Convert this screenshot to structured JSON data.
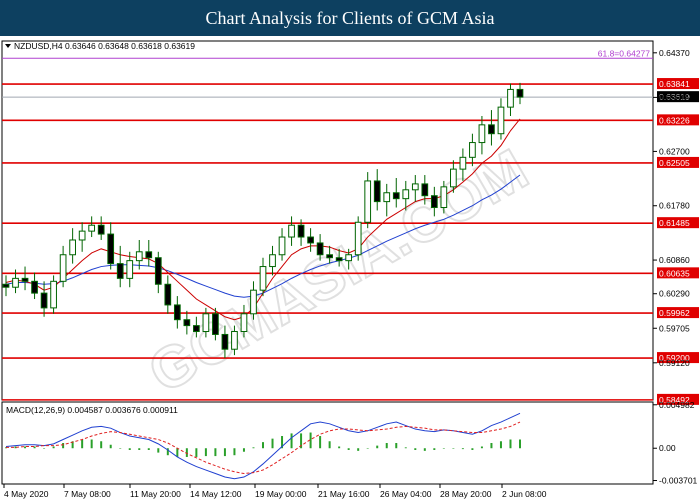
{
  "banner": {
    "title": "Chart Analysis for Clients of GCM Asia"
  },
  "watermark": {
    "text": "GCMASIA.COM"
  },
  "colors": {
    "level_line": "#e00000",
    "fib_line": "#b040d0",
    "price_line": "#a0a8b0",
    "candle_up": "#006400",
    "candle_body_down": "#000000",
    "ma_fast": "#cc0000",
    "ma_slow": "#2040d0",
    "macd_line": "#2040d0",
    "macd_signal": "#e02020",
    "macd_hist": "#2aa02a"
  },
  "chart_data": [
    {
      "type": "candlestick",
      "title": "NZDUSD,H4  0.63646 0.63648 0.63618 0.63619",
      "x_tick_labels": [
        "4 May 2020",
        "7 May 08:00",
        "11 May 20:00",
        "14 May 12:00",
        "19 May 00:00",
        "21 May 16:00",
        "26 May 04:00",
        "28 May 20:00",
        "2 Jun 08:00"
      ],
      "y_tick_labels": [
        "0.64370",
        "0.63615",
        "0.62700",
        "0.61780",
        "0.60860",
        "0.60290",
        "0.59705",
        "0.59120"
      ],
      "ylim": [
        0.5849,
        0.6457
      ],
      "levels": [
        "0.63841",
        "0.63226",
        "0.62505",
        "0.61485",
        "0.60635",
        "0.59962",
        "0.59200",
        "0.58492"
      ],
      "fib_label": "61.8=0.64277",
      "current_price": "0.63619",
      "candles": [
        {
          "o": 0.6045,
          "h": 0.606,
          "l": 0.6025,
          "c": 0.604
        },
        {
          "o": 0.604,
          "h": 0.607,
          "l": 0.603,
          "c": 0.6055
        },
        {
          "o": 0.6055,
          "h": 0.6075,
          "l": 0.6035,
          "c": 0.605
        },
        {
          "o": 0.605,
          "h": 0.6065,
          "l": 0.602,
          "c": 0.603
        },
        {
          "o": 0.603,
          "h": 0.605,
          "l": 0.599,
          "c": 0.6005
        },
        {
          "o": 0.6005,
          "h": 0.606,
          "l": 0.5995,
          "c": 0.605
        },
        {
          "o": 0.605,
          "h": 0.611,
          "l": 0.604,
          "c": 0.6095
        },
        {
          "o": 0.6095,
          "h": 0.614,
          "l": 0.608,
          "c": 0.612
        },
        {
          "o": 0.612,
          "h": 0.615,
          "l": 0.61,
          "c": 0.6135
        },
        {
          "o": 0.6135,
          "h": 0.616,
          "l": 0.6125,
          "c": 0.6145
        },
        {
          "o": 0.6145,
          "h": 0.616,
          "l": 0.612,
          "c": 0.613
        },
        {
          "o": 0.613,
          "h": 0.615,
          "l": 0.607,
          "c": 0.608
        },
        {
          "o": 0.608,
          "h": 0.611,
          "l": 0.604,
          "c": 0.6055
        },
        {
          "o": 0.6055,
          "h": 0.61,
          "l": 0.604,
          "c": 0.6085
        },
        {
          "o": 0.6085,
          "h": 0.612,
          "l": 0.607,
          "c": 0.61
        },
        {
          "o": 0.61,
          "h": 0.612,
          "l": 0.6075,
          "c": 0.609
        },
        {
          "o": 0.609,
          "h": 0.61,
          "l": 0.603,
          "c": 0.6045
        },
        {
          "o": 0.6045,
          "h": 0.606,
          "l": 0.5995,
          "c": 0.601
        },
        {
          "o": 0.601,
          "h": 0.6025,
          "l": 0.597,
          "c": 0.5985
        },
        {
          "o": 0.5985,
          "h": 0.6,
          "l": 0.596,
          "c": 0.5975
        },
        {
          "o": 0.5975,
          "h": 0.599,
          "l": 0.5955,
          "c": 0.5965
        },
        {
          "o": 0.5965,
          "h": 0.6005,
          "l": 0.5955,
          "c": 0.5995
        },
        {
          "o": 0.5995,
          "h": 0.6005,
          "l": 0.595,
          "c": 0.596
        },
        {
          "o": 0.596,
          "h": 0.5975,
          "l": 0.592,
          "c": 0.5935
        },
        {
          "o": 0.5935,
          "h": 0.5975,
          "l": 0.5925,
          "c": 0.5965
        },
        {
          "o": 0.5965,
          "h": 0.601,
          "l": 0.5955,
          "c": 0.5995
        },
        {
          "o": 0.5995,
          "h": 0.605,
          "l": 0.5985,
          "c": 0.6035
        },
        {
          "o": 0.6035,
          "h": 0.609,
          "l": 0.6025,
          "c": 0.6075
        },
        {
          "o": 0.6075,
          "h": 0.611,
          "l": 0.606,
          "c": 0.6095
        },
        {
          "o": 0.6095,
          "h": 0.614,
          "l": 0.6085,
          "c": 0.6125
        },
        {
          "o": 0.6125,
          "h": 0.616,
          "l": 0.611,
          "c": 0.6145
        },
        {
          "o": 0.6145,
          "h": 0.6155,
          "l": 0.611,
          "c": 0.6125
        },
        {
          "o": 0.6125,
          "h": 0.614,
          "l": 0.61,
          "c": 0.6115
        },
        {
          "o": 0.6115,
          "h": 0.613,
          "l": 0.6085,
          "c": 0.6095
        },
        {
          "o": 0.6095,
          "h": 0.611,
          "l": 0.608,
          "c": 0.609
        },
        {
          "o": 0.609,
          "h": 0.6105,
          "l": 0.6075,
          "c": 0.6085
        },
        {
          "o": 0.6085,
          "h": 0.6105,
          "l": 0.607,
          "c": 0.6095
        },
        {
          "o": 0.6095,
          "h": 0.616,
          "l": 0.6085,
          "c": 0.615
        },
        {
          "o": 0.615,
          "h": 0.6235,
          "l": 0.614,
          "c": 0.622
        },
        {
          "o": 0.622,
          "h": 0.624,
          "l": 0.617,
          "c": 0.6185
        },
        {
          "o": 0.6185,
          "h": 0.6215,
          "l": 0.616,
          "c": 0.62
        },
        {
          "o": 0.62,
          "h": 0.6225,
          "l": 0.6175,
          "c": 0.619
        },
        {
          "o": 0.619,
          "h": 0.622,
          "l": 0.617,
          "c": 0.6205
        },
        {
          "o": 0.6205,
          "h": 0.623,
          "l": 0.6185,
          "c": 0.6215
        },
        {
          "o": 0.6215,
          "h": 0.623,
          "l": 0.618,
          "c": 0.6195
        },
        {
          "o": 0.6195,
          "h": 0.621,
          "l": 0.616,
          "c": 0.6175
        },
        {
          "o": 0.6175,
          "h": 0.622,
          "l": 0.6165,
          "c": 0.621
        },
        {
          "o": 0.621,
          "h": 0.6255,
          "l": 0.62,
          "c": 0.624
        },
        {
          "o": 0.624,
          "h": 0.6275,
          "l": 0.622,
          "c": 0.626
        },
        {
          "o": 0.626,
          "h": 0.63,
          "l": 0.6245,
          "c": 0.6285
        },
        {
          "o": 0.6285,
          "h": 0.633,
          "l": 0.6265,
          "c": 0.6315
        },
        {
          "o": 0.6315,
          "h": 0.634,
          "l": 0.628,
          "c": 0.63
        },
        {
          "o": 0.63,
          "h": 0.636,
          "l": 0.629,
          "c": 0.6345
        },
        {
          "o": 0.6345,
          "h": 0.6385,
          "l": 0.633,
          "c": 0.6375
        },
        {
          "o": 0.6375,
          "h": 0.6386,
          "l": 0.635,
          "c": 0.6362
        }
      ],
      "ma_fast": [
        0.6048,
        0.6052,
        0.605,
        0.6045,
        0.6035,
        0.604,
        0.6055,
        0.607,
        0.6085,
        0.6098,
        0.6105,
        0.61,
        0.6095,
        0.6092,
        0.609,
        0.6088,
        0.608,
        0.6065,
        0.605,
        0.6035,
        0.602,
        0.601,
        0.6,
        0.599,
        0.5985,
        0.599,
        0.6005,
        0.603,
        0.6055,
        0.6075,
        0.6095,
        0.6105,
        0.611,
        0.611,
        0.6108,
        0.6102,
        0.6098,
        0.6105,
        0.6125,
        0.614,
        0.6155,
        0.6165,
        0.6175,
        0.6185,
        0.619,
        0.619,
        0.6195,
        0.6205,
        0.6218,
        0.6232,
        0.625,
        0.6262,
        0.628,
        0.6305,
        0.6325
      ],
      "ma_slow": [
        0.6045,
        0.6048,
        0.6048,
        0.6047,
        0.6045,
        0.6046,
        0.605,
        0.6056,
        0.6063,
        0.607,
        0.6075,
        0.6077,
        0.6078,
        0.6078,
        0.6077,
        0.6076,
        0.6073,
        0.6068,
        0.6062,
        0.6055,
        0.6048,
        0.6042,
        0.6036,
        0.603,
        0.6025,
        0.6023,
        0.6025,
        0.603,
        0.6038,
        0.6046,
        0.6055,
        0.6063,
        0.607,
        0.6076,
        0.6081,
        0.6085,
        0.6089,
        0.6094,
        0.6102,
        0.611,
        0.6118,
        0.6125,
        0.6132,
        0.6139,
        0.6145,
        0.615,
        0.6155,
        0.6162,
        0.617,
        0.6178,
        0.6188,
        0.6196,
        0.6206,
        0.6218,
        0.623
      ]
    },
    {
      "type": "macd",
      "title": "MACD(12,26,9) 0.004587 0.003676 0.000911",
      "y_tick_labels": [
        "0.004982",
        "0.00",
        "-0.003701"
      ],
      "ylim": [
        -0.0041,
        0.0053
      ],
      "macd": [
        0.0002,
        0.0003,
        0.0004,
        0.0004,
        0.0003,
        0.0005,
        0.001,
        0.0015,
        0.002,
        0.0024,
        0.0025,
        0.0023,
        0.0018,
        0.0014,
        0.0012,
        0.001,
        0.0005,
        -0.0002,
        -0.001,
        -0.0016,
        -0.0021,
        -0.0025,
        -0.0029,
        -0.0033,
        -0.0035,
        -0.0033,
        -0.0027,
        -0.0018,
        -0.0008,
        0.0002,
        0.0012,
        0.002,
        0.0028,
        0.003,
        0.0028,
        0.0024,
        0.002,
        0.0018,
        0.002,
        0.0024,
        0.0028,
        0.003,
        0.0026,
        0.0022,
        0.002,
        0.0019,
        0.0021,
        0.002,
        0.0018,
        0.0016,
        0.002,
        0.0026,
        0.003,
        0.0035,
        0.004
      ],
      "signal": [
        0.0001,
        0.0001,
        0.0002,
        0.0002,
        0.0003,
        0.0003,
        0.0004,
        0.0007,
        0.001,
        0.0014,
        0.0017,
        0.0019,
        0.0018,
        0.0016,
        0.0014,
        0.0012,
        0.001,
        0.0006,
        0.0,
        -0.0006,
        -0.0011,
        -0.0016,
        -0.002,
        -0.0024,
        -0.0027,
        -0.0029,
        -0.0028,
        -0.0025,
        -0.0019,
        -0.0012,
        -0.0005,
        0.0003,
        0.001,
        0.0016,
        0.002,
        0.0022,
        0.0022,
        0.0021,
        0.002,
        0.0021,
        0.0022,
        0.0024,
        0.0025,
        0.0024,
        0.0023,
        0.0021,
        0.0021,
        0.002,
        0.0019,
        0.0018,
        0.0018,
        0.002,
        0.0022,
        0.0025,
        0.003
      ]
    }
  ]
}
